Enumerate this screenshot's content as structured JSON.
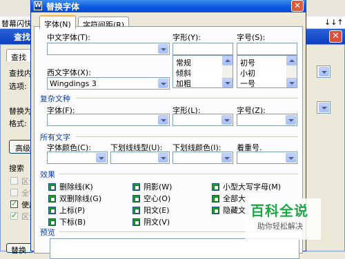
{
  "background_window": {
    "top_text": "替幕闪快",
    "top_right_marks": "↓↓↑",
    "title": "查找",
    "close_glyph": "✕",
    "tab_find": "查找",
    "labels": {
      "find_content": "查找内",
      "options": "选项:",
      "replace_with": "替换为",
      "format": "格式:",
      "advanced_button": "高级",
      "search": "搜索",
      "opt1": "区分",
      "opt2": "全字",
      "opt3": "使用",
      "opt4": "区分",
      "replace_button": "替换"
    }
  },
  "dialog": {
    "title": "替换字体",
    "icon_text": "W",
    "close_glyph": "✕",
    "tabs": [
      "字体(N)",
      "字符间距(R)"
    ],
    "labels": {
      "chinese_font": "中文字体(T):",
      "style": "字形(Y):",
      "size": "字号(S):",
      "western_font": "西文字体(X):"
    },
    "values": {
      "chinese_font": "",
      "western_font": "Wingdings 3",
      "style": "",
      "size": ""
    },
    "style_list": [
      "常规",
      "倾斜",
      "加粗"
    ],
    "size_list": [
      "初号",
      "小初",
      "一号"
    ],
    "complex_section": {
      "title": "复杂文种",
      "font_label": "字体(F):",
      "style_label": "字形(L):",
      "size_label": "字号(Z):"
    },
    "all_text_section": {
      "title": "所有文字",
      "font_color": "字体颜色(C):",
      "underline_type": "下划线线型(U):",
      "underline_color": "下划线颜色(I):",
      "emphasis": "着重号."
    },
    "effects_section": {
      "title": "效果",
      "col1": [
        "删除线(K)",
        "双删除线(G)",
        "上标(P)",
        "下标(B)"
      ],
      "col2": [
        "阴影(W)",
        "空心(O)",
        "阳文(E)",
        "阴文(V)"
      ],
      "col3": [
        "小型大写字母(M)",
        "全部大",
        "隐藏文"
      ]
    },
    "preview_title": "预览"
  },
  "watermark": {
    "big": "百科全说",
    "small": "助你轻松解决"
  },
  "colors": {
    "title_bar": "#0b55e0",
    "section_text": "#0c3fa6",
    "checkbox_fill": "#1b9e2e"
  }
}
